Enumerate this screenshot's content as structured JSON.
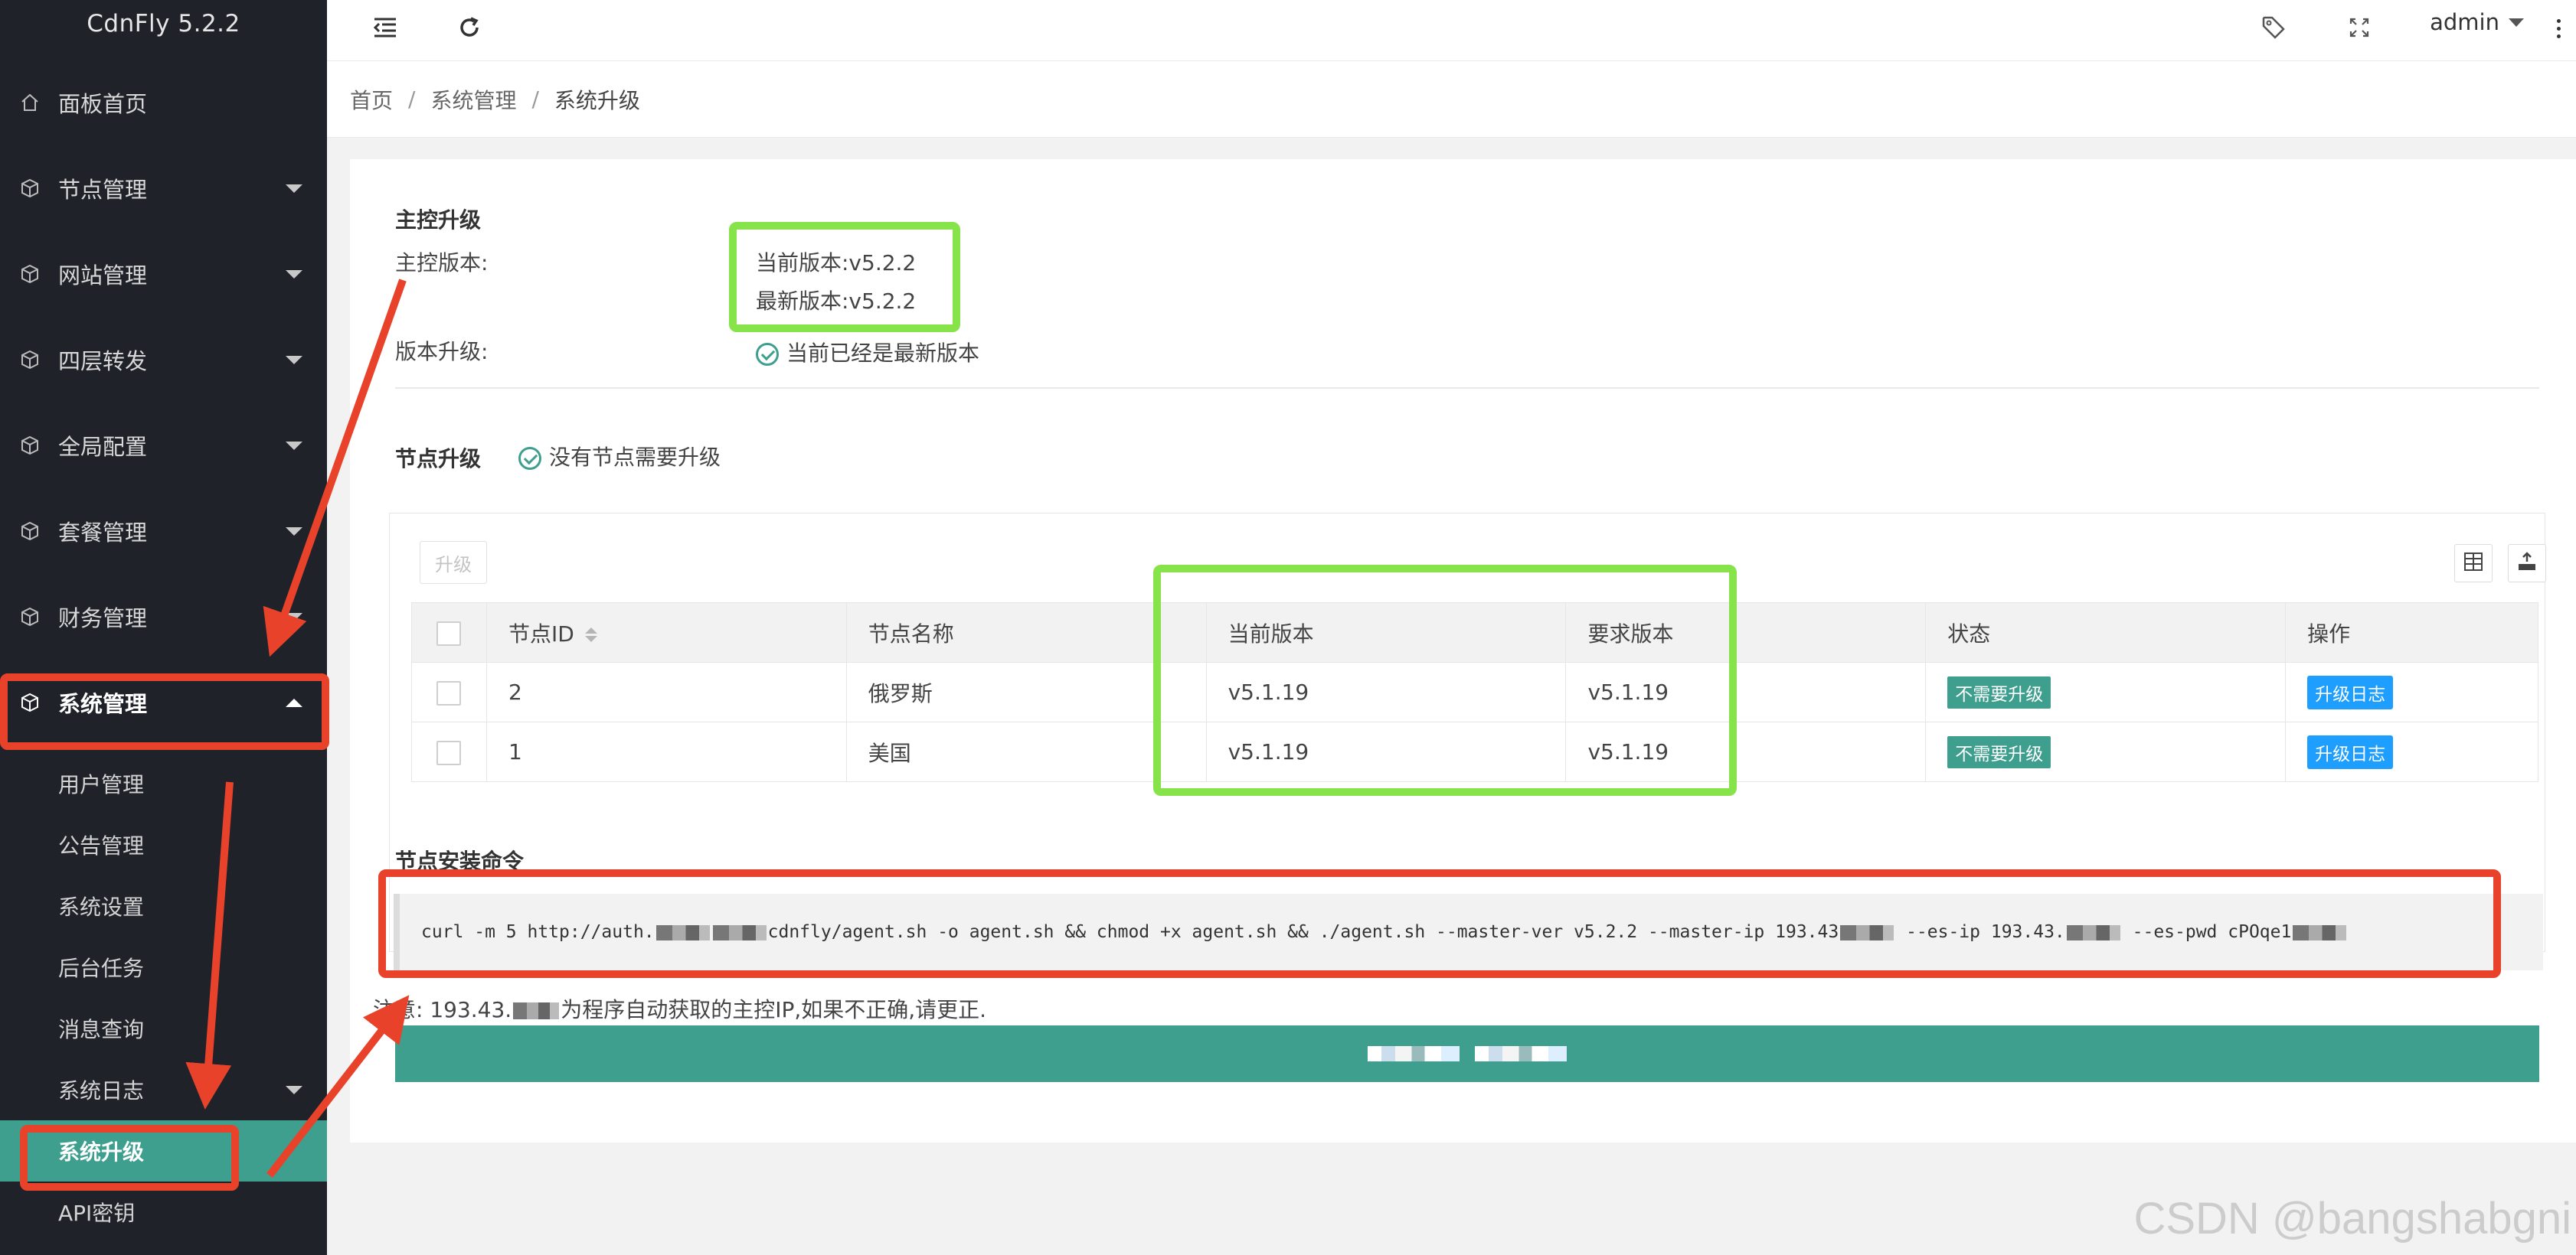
{
  "app": {
    "name": "CdnFly 5.2.2"
  },
  "sidebar": {
    "items": [
      {
        "label": "面板首页"
      },
      {
        "label": "节点管理"
      },
      {
        "label": "网站管理"
      },
      {
        "label": "四层转发"
      },
      {
        "label": "全局配置"
      },
      {
        "label": "套餐管理"
      },
      {
        "label": "财务管理"
      },
      {
        "label": "系统管理"
      }
    ],
    "sub_items": [
      {
        "label": "用户管理"
      },
      {
        "label": "公告管理"
      },
      {
        "label": "系统设置"
      },
      {
        "label": "后台任务"
      },
      {
        "label": "消息查询"
      },
      {
        "label": "系统日志"
      },
      {
        "label": "系统升级"
      },
      {
        "label": "API密钥"
      }
    ]
  },
  "header": {
    "user": "admin"
  },
  "breadcrumb": {
    "home": "首页",
    "parent": "系统管理",
    "current": "系统升级"
  },
  "master": {
    "section_title": "主控升级",
    "version_label": "主控版本:",
    "current_version": "当前版本:v5.2.2",
    "latest_version": "最新版本:v5.2.2",
    "upgrade_label": "版本升级:",
    "upgrade_status": "当前已经是最新版本"
  },
  "nodes": {
    "section_title": "节点升级",
    "status": "没有节点需要升级",
    "upgrade_button": "升级",
    "columns": [
      "节点ID",
      "节点名称",
      "当前版本",
      "要求版本",
      "状态",
      "操作"
    ],
    "rows": [
      {
        "id": "2",
        "name": "俄罗斯",
        "current": "v5.1.19",
        "required": "v5.1.19",
        "status": "不需要升级",
        "action": "升级日志"
      },
      {
        "id": "1",
        "name": "美国",
        "current": "v5.1.19",
        "required": "v5.1.19",
        "status": "不需要升级",
        "action": "升级日志"
      }
    ]
  },
  "install": {
    "section_title": "节点安装命令",
    "cmd_part1": "curl -m 5 http://auth.",
    "cmd_part2": "cdnfly/agent.sh -o agent.sh  && chmod +x agent.sh && ./agent.sh --master-ver v5.2.2 --master-ip 193.43",
    "cmd_part3": " --es-ip 193.43.",
    "cmd_part4": " --es-pwd cPOqe1",
    "note_prefix": "注意: 193.43.",
    "note_suffix": "为程序自动获取的主控IP,如果不正确,请更正."
  },
  "watermark": "CSDN @bangshabgni",
  "colors": {
    "sidebar_bg": "#20222a",
    "accent": "#3f9f8e",
    "blue": "#1e9fff",
    "annotation_green": "#86e34a",
    "annotation_red": "#e8432a"
  }
}
